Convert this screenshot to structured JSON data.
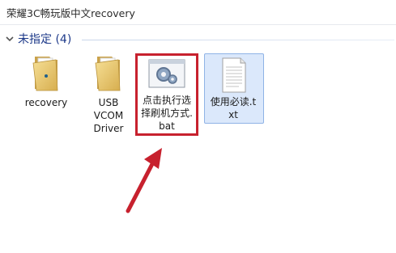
{
  "window": {
    "title": "荣耀3C畅玩版中文recovery"
  },
  "group": {
    "label": "未指定 (4)"
  },
  "files": [
    {
      "label": "recovery",
      "icon": "folder-icon"
    },
    {
      "label": "USB VCOM Driver",
      "icon": "folder-icon"
    },
    {
      "label": "点击执行选择刷机方式.bat",
      "icon": "batch-file-gear-icon"
    },
    {
      "label": "使用必读.txt",
      "icon": "text-file-icon"
    }
  ],
  "colors": {
    "highlight": "#c7212e",
    "selection": "#dbe8fb",
    "group_header": "#1e3a8a"
  }
}
